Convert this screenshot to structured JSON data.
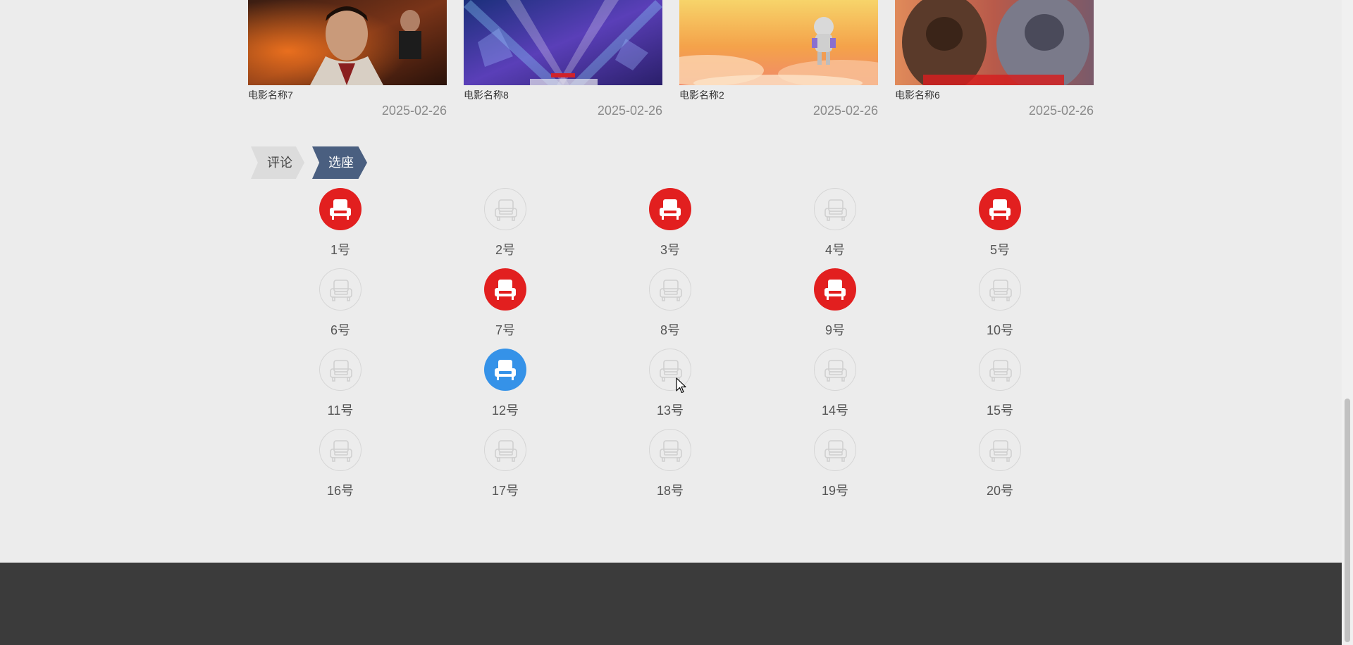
{
  "movies": [
    {
      "name": "电影名称7",
      "date": "2025-02-26"
    },
    {
      "name": "电影名称8",
      "date": "2025-02-26"
    },
    {
      "name": "电影名称2",
      "date": "2025-02-26"
    },
    {
      "name": "电影名称6",
      "date": "2025-02-26"
    }
  ],
  "tabs": {
    "comment": "评论",
    "seat": "选座",
    "active": "seat"
  },
  "seats": [
    {
      "label": "1号",
      "status": "sold"
    },
    {
      "label": "2号",
      "status": "free"
    },
    {
      "label": "3号",
      "status": "sold"
    },
    {
      "label": "4号",
      "status": "free"
    },
    {
      "label": "5号",
      "status": "sold"
    },
    {
      "label": "6号",
      "status": "free"
    },
    {
      "label": "7号",
      "status": "sold"
    },
    {
      "label": "8号",
      "status": "free"
    },
    {
      "label": "9号",
      "status": "sold"
    },
    {
      "label": "10号",
      "status": "free"
    },
    {
      "label": "11号",
      "status": "free"
    },
    {
      "label": "12号",
      "status": "selected"
    },
    {
      "label": "13号",
      "status": "free"
    },
    {
      "label": "14号",
      "status": "free"
    },
    {
      "label": "15号",
      "status": "free"
    },
    {
      "label": "16号",
      "status": "free"
    },
    {
      "label": "17号",
      "status": "free"
    },
    {
      "label": "18号",
      "status": "free"
    },
    {
      "label": "19号",
      "status": "free"
    },
    {
      "label": "20号",
      "status": "free"
    }
  ],
  "colors": {
    "sold": "#e21f1f",
    "selected": "#3592e8",
    "free_outline": "#d6d6d6",
    "tab_active": "#4a5f80",
    "tab_inactive": "#dcdcdc",
    "footer": "#3b3b3b",
    "background": "#ececec"
  },
  "icons": {
    "seat": "armchair-icon"
  }
}
